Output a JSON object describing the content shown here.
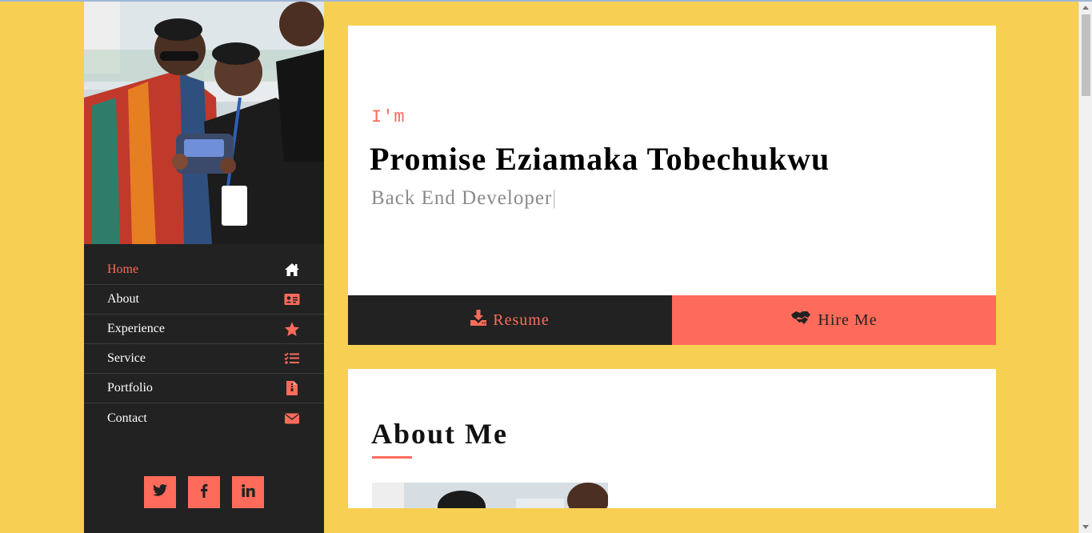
{
  "nav": {
    "items": [
      {
        "label": "Home",
        "icon": "home-icon",
        "active": true
      },
      {
        "label": "About",
        "icon": "id-card-icon"
      },
      {
        "label": "Experience",
        "icon": "star-icon"
      },
      {
        "label": "Service",
        "icon": "tasks-icon"
      },
      {
        "label": "Portfolio",
        "icon": "file-icon"
      },
      {
        "label": "Contact",
        "icon": "envelope-icon"
      }
    ]
  },
  "socials": [
    {
      "label": "twitter",
      "icon": "twitter-icon"
    },
    {
      "label": "facebook",
      "icon": "facebook-icon"
    },
    {
      "label": "linkedin",
      "icon": "linkedin-icon"
    }
  ],
  "hero": {
    "intro": "I'm",
    "name": "Promise Eziamaka Tobechukwu",
    "role": "Back End Developer",
    "cursor": "|"
  },
  "buttons": {
    "resume_label": "Resume",
    "hire_label": "Hire Me"
  },
  "about": {
    "title": "About Me"
  },
  "colors": {
    "background": "#f7cf52",
    "accent": "#ff6b5b",
    "sidebar": "#222222",
    "card": "#ffffff"
  }
}
